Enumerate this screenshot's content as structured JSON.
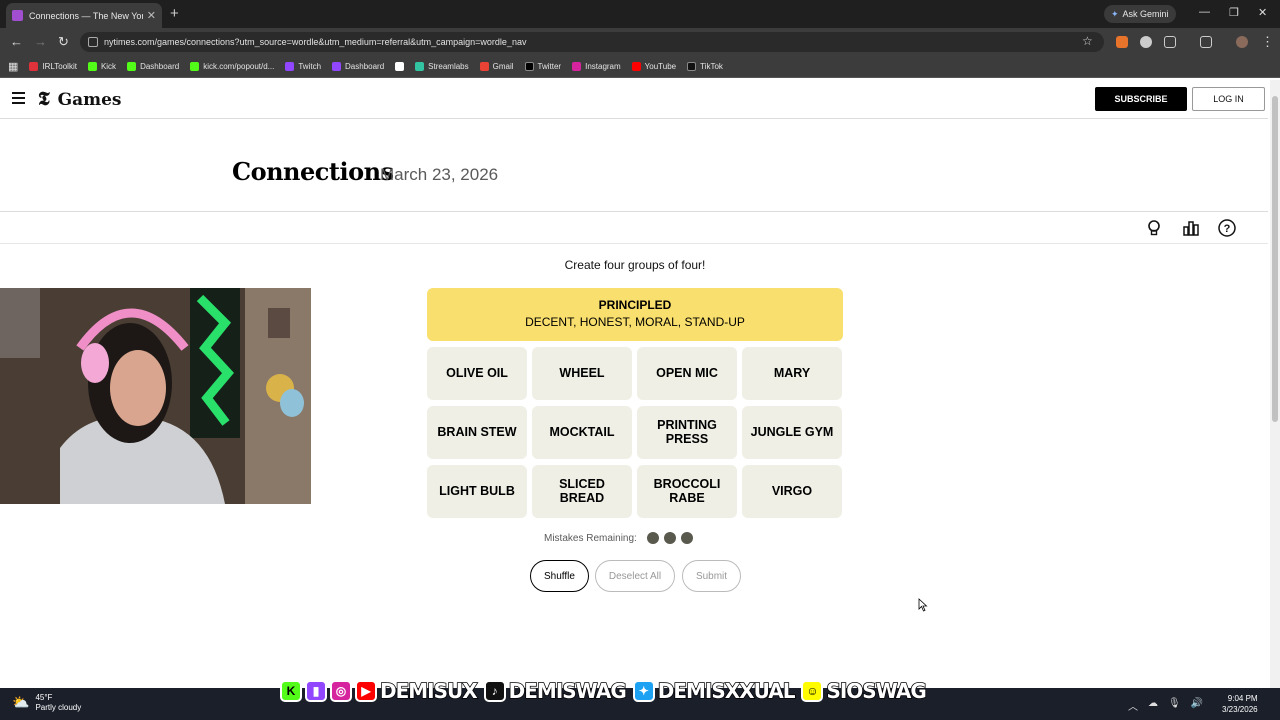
{
  "browser": {
    "tab_title": "Connections — The New York",
    "new_tab": "+",
    "ask_gemini": "Ask Gemini",
    "url": "nytimes.com/games/connections?utm_source=wordle&utm_medium=referral&utm_campaign=wordle_nav",
    "bookmarks": [
      {
        "label": "IRLToolkit",
        "color": "#e0323a"
      },
      {
        "label": "Kick",
        "color": "#53fc18"
      },
      {
        "label": "Dashboard",
        "color": "#53fc18"
      },
      {
        "label": "kick.com/popout/d...",
        "color": "#53fc18"
      },
      {
        "label": "Twitch",
        "color": "#9146ff"
      },
      {
        "label": "Dashboard",
        "color": "#9146ff"
      },
      {
        "label": "",
        "color": "#ffffff"
      },
      {
        "label": "Streamlabs",
        "color": "#31c3a2"
      },
      {
        "label": "Gmail",
        "color": "#ea4335"
      },
      {
        "label": "Twitter",
        "color": "#000000"
      },
      {
        "label": "Instagram",
        "color": "#d6249f"
      },
      {
        "label": "YouTube",
        "color": "#ff0000"
      },
      {
        "label": "TikTok",
        "color": "#111111"
      }
    ]
  },
  "header": {
    "logo": "Games",
    "subscribe": "SUBSCRIBE",
    "login": "LOG IN"
  },
  "game": {
    "title": "Connections",
    "date": "March 23, 2026",
    "instructions": "Create four groups of four!",
    "solved_groups": [
      {
        "category": "PRINCIPLED",
        "words": "DECENT, HONEST, MORAL, STAND-UP",
        "color": "#f9df6d"
      }
    ],
    "cards": [
      "OLIVE OIL",
      "WHEEL",
      "OPEN MIC",
      "MARY",
      "BRAIN STEW",
      "MOCKTAIL",
      "PRINTING PRESS",
      "JUNGLE GYM",
      "LIGHT BULB",
      "SLICED BREAD",
      "BROCCOLI RABE",
      "VIRGO"
    ],
    "mistakes_label": "Mistakes Remaining:",
    "mistakes_remaining": 3,
    "buttons": {
      "shuffle": "Shuffle",
      "deselect": "Deselect All",
      "submit": "Submit"
    }
  },
  "overlay": {
    "handles": [
      "DEMISUX",
      "DEMISWAG",
      "DEMISXXUAL",
      "SIOSWAG"
    ]
  },
  "taskbar": {
    "temp": "45°F",
    "condition": "Partly cloudy",
    "time": "9:04 PM",
    "date": "3/23/2026"
  }
}
